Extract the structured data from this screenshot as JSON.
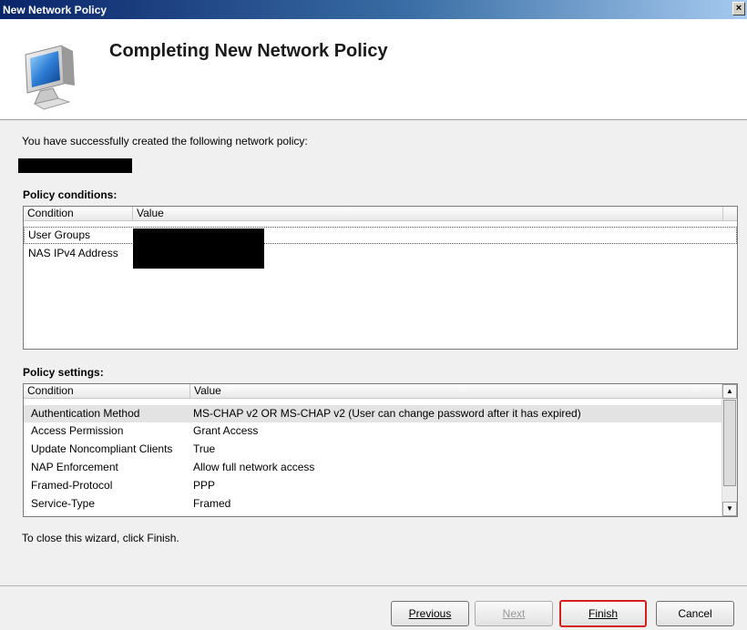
{
  "window": {
    "title": "New Network Policy",
    "close_glyph": "×"
  },
  "header": {
    "title": "Completing New Network Policy",
    "icon": "computer-monitor-icon"
  },
  "intro_text": "You have successfully created the following network policy:",
  "policy_conditions": {
    "label": "Policy conditions:",
    "columns": [
      "Condition",
      "Value"
    ],
    "rows": [
      {
        "condition": "User Groups",
        "value": ""
      },
      {
        "condition": "NAS IPv4 Address",
        "value": ""
      }
    ]
  },
  "policy_settings": {
    "label": "Policy settings:",
    "columns": [
      "Condition",
      "Value"
    ],
    "rows": [
      {
        "condition": "Authentication Method",
        "value": "MS-CHAP v2 OR MS-CHAP v2 (User can change password after it has expired)"
      },
      {
        "condition": "Access Permission",
        "value": "Grant Access"
      },
      {
        "condition": "Update Noncompliant Clients",
        "value": "True"
      },
      {
        "condition": "NAP Enforcement",
        "value": "Allow full network access"
      },
      {
        "condition": "Framed-Protocol",
        "value": "PPP"
      },
      {
        "condition": "Service-Type",
        "value": "Framed"
      }
    ]
  },
  "close_hint": "To close this wizard, click Finish.",
  "buttons": {
    "previous": "Previous",
    "next": "Next",
    "finish": "Finish",
    "cancel": "Cancel"
  },
  "colors": {
    "titlebar": "#0a246a",
    "finish_highlight": "#d41f1f"
  }
}
